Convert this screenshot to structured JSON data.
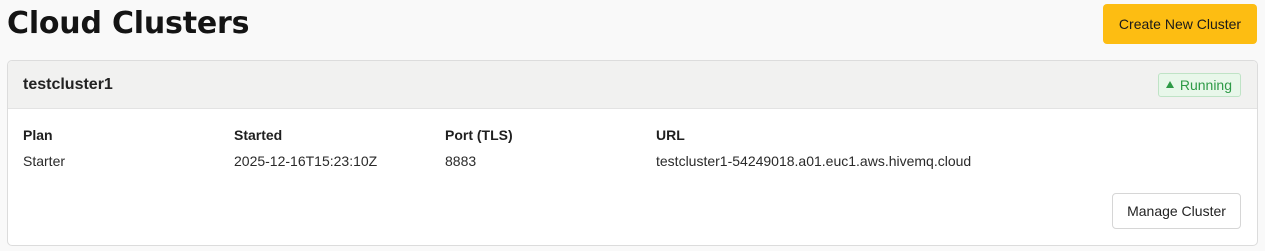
{
  "page": {
    "title": "Cloud Clusters",
    "create_button_label": "Create New Cluster"
  },
  "colors": {
    "accent": "#fdbd12",
    "running_status": "#2e9a47",
    "running_status_bg": "#e8f7ea",
    "card_header_bg": "#f1f1f0"
  },
  "clusters": [
    {
      "name": "testcluster1",
      "status": {
        "label": "Running",
        "icon": "triangle-up-icon"
      },
      "fields": {
        "plan": {
          "label": "Plan",
          "value": "Starter"
        },
        "started": {
          "label": "Started",
          "value": "2025-12-16T15:23:10Z"
        },
        "port": {
          "label": "Port (TLS)",
          "value": "8883"
        },
        "url": {
          "label": "URL",
          "value": "testcluster1-54249018.a01.euc1.aws.hivemq.cloud"
        }
      },
      "manage_button_label": "Manage Cluster"
    }
  ]
}
